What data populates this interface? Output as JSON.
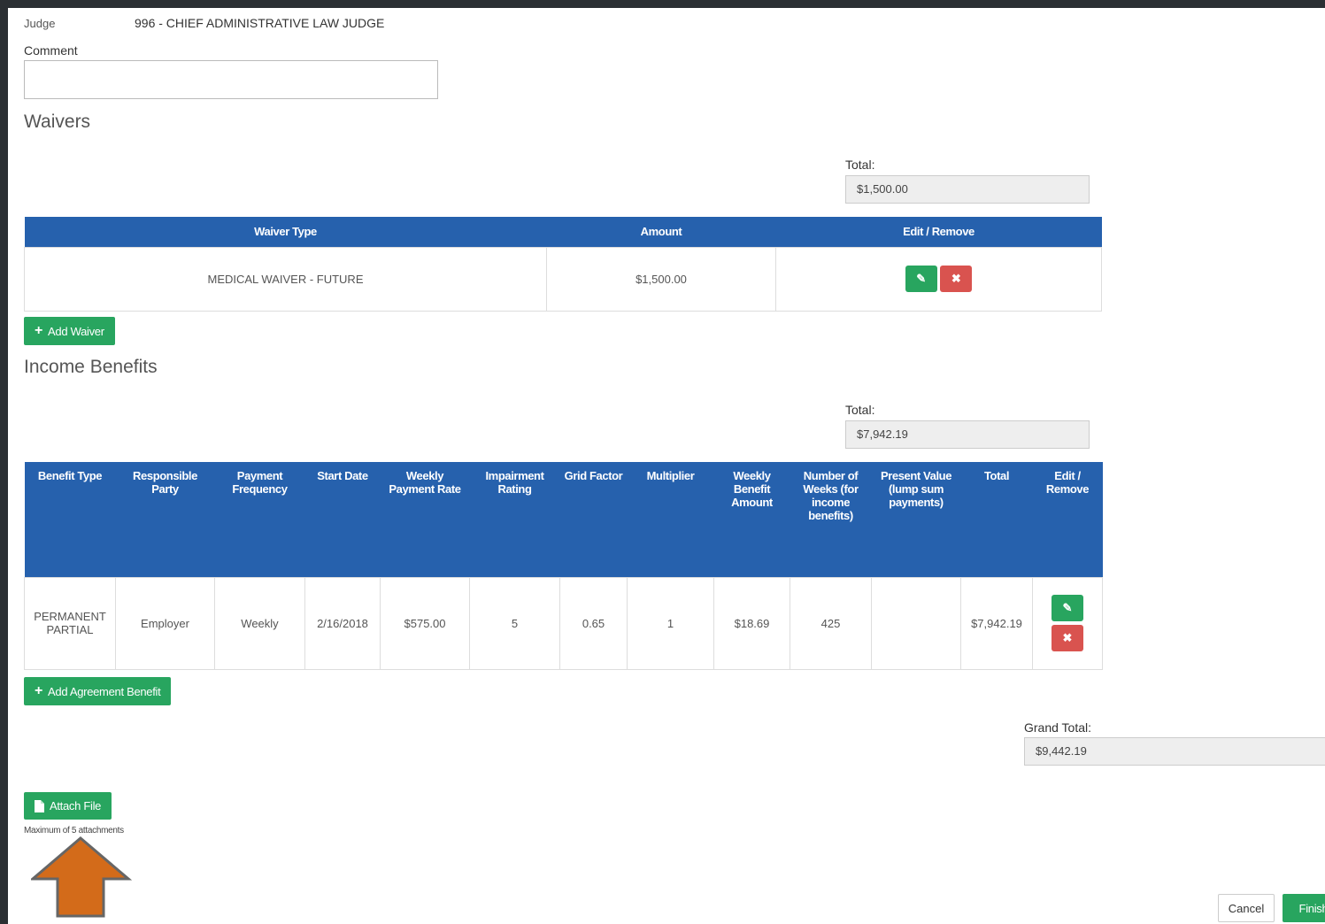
{
  "judge": {
    "label": "Judge",
    "value": "996 - CHIEF ADMINISTRATIVE LAW JUDGE"
  },
  "comment": {
    "label": "Comment",
    "value": ""
  },
  "waivers": {
    "title": "Waivers",
    "total_label": "Total:",
    "total_value": "$1,500.00",
    "columns": [
      "Waiver Type",
      "Amount",
      "Edit / Remove"
    ],
    "rows": [
      {
        "type": "MEDICAL WAIVER - FUTURE",
        "amount": "$1,500.00"
      }
    ],
    "add_label": "Add Waiver"
  },
  "income": {
    "title": "Income Benefits",
    "total_label": "Total:",
    "total_value": "$7,942.19",
    "columns": [
      "Benefit Type",
      "Responsible Party",
      "Payment Frequency",
      "Start Date",
      "Weekly Payment Rate",
      "Impairment Rating",
      "Grid Factor",
      "Multiplier",
      "Weekly Benefit Amount",
      "Number of Weeks (for income benefits)",
      "Present Value (lump sum payments)",
      "Total",
      "Edit / Remove"
    ],
    "rows": [
      {
        "benefit_type": "PERMANENT PARTIAL",
        "responsible_party": "Employer",
        "payment_frequency": "Weekly",
        "start_date": "2/16/2018",
        "weekly_payment_rate": "$575.00",
        "impairment_rating": "5",
        "grid_factor": "0.65",
        "multiplier": "1",
        "weekly_benefit_amount": "$18.69",
        "number_of_weeks": "425",
        "present_value": "",
        "total": "$7,942.19"
      }
    ],
    "add_label": "Add Agreement Benefit"
  },
  "grand_total": {
    "label": "Grand Total:",
    "value": "$9,442.19"
  },
  "attach": {
    "label": "Attach File",
    "note": "Maximum of 5 attachments"
  },
  "footer": {
    "cancel": "Cancel",
    "finish": "Finish"
  },
  "colors": {
    "header_blue": "#2661ad",
    "success_green": "#28a55f",
    "danger_red": "#d9534f",
    "arrow_orange": "#d36b1a"
  },
  "icons": {
    "edit": "pencil-icon",
    "remove": "close-icon",
    "add": "plus-icon",
    "attach": "file-icon",
    "annotation": "up-arrow-icon"
  }
}
